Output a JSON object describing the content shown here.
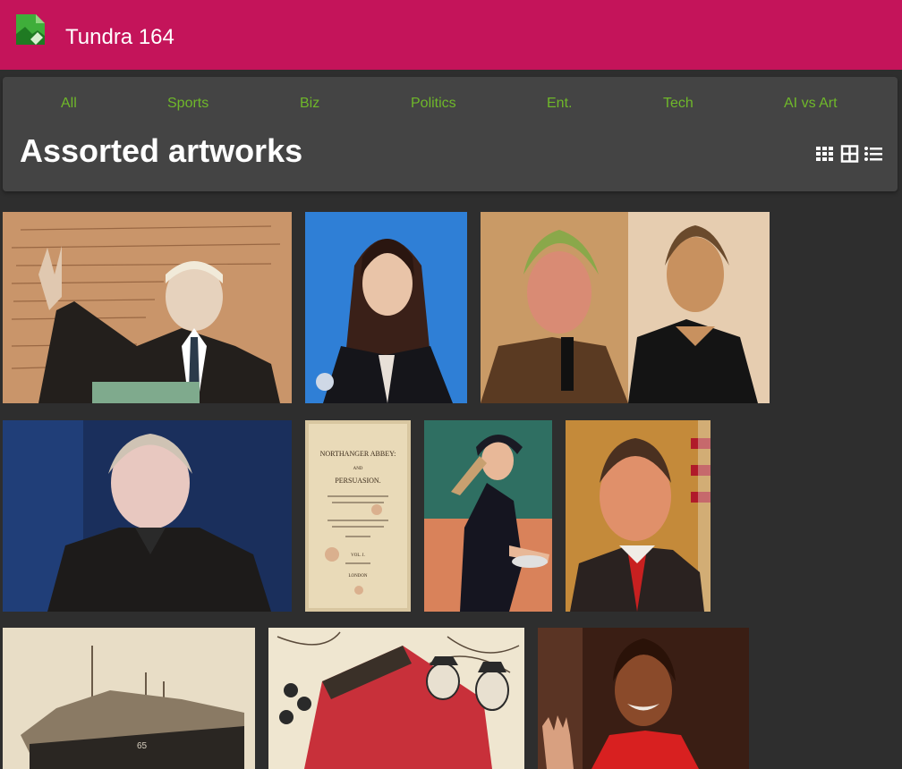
{
  "site": {
    "title": "Tundra 164",
    "logo_icon": "broken-image-icon",
    "brand_color": "#c4145a"
  },
  "nav": {
    "items": [
      {
        "label": "All"
      },
      {
        "label": "Sports"
      },
      {
        "label": "Biz"
      },
      {
        "label": "Politics"
      },
      {
        "label": "Ent."
      },
      {
        "label": "Tech"
      },
      {
        "label": "AI vs Art"
      }
    ],
    "link_color": "#6fb82a"
  },
  "page": {
    "title": "Assorted artworks"
  },
  "view_toggles": [
    {
      "icon": "grid-small-icon"
    },
    {
      "icon": "grid-large-icon"
    },
    {
      "icon": "list-icon"
    }
  ],
  "gallery": {
    "tiles": [
      {
        "subject": "man-waving-at-podium-over-manuscript"
      },
      {
        "subject": "woman-long-dark-hair-blue-background"
      },
      {
        "subject": "two-portraits-man-with-microphone-and-woman"
      },
      {
        "subject": "gray-haired-man-dark-background"
      },
      {
        "subject": "old-book-title-page"
      },
      {
        "subject": "tennis-player"
      },
      {
        "subject": "smiling-man-in-suit-with-flag"
      },
      {
        "subject": "sailing-ship-sketch"
      },
      {
        "subject": "illustrated-barn-with-figures"
      },
      {
        "subject": "smiling-woman-waving"
      }
    ],
    "book_page_text": {
      "line1": "NORTHANGER ABBEY:",
      "line2": "AND",
      "line3": "PERSUASION.",
      "line4": "VOL. I.",
      "line5": "LONDON"
    }
  }
}
